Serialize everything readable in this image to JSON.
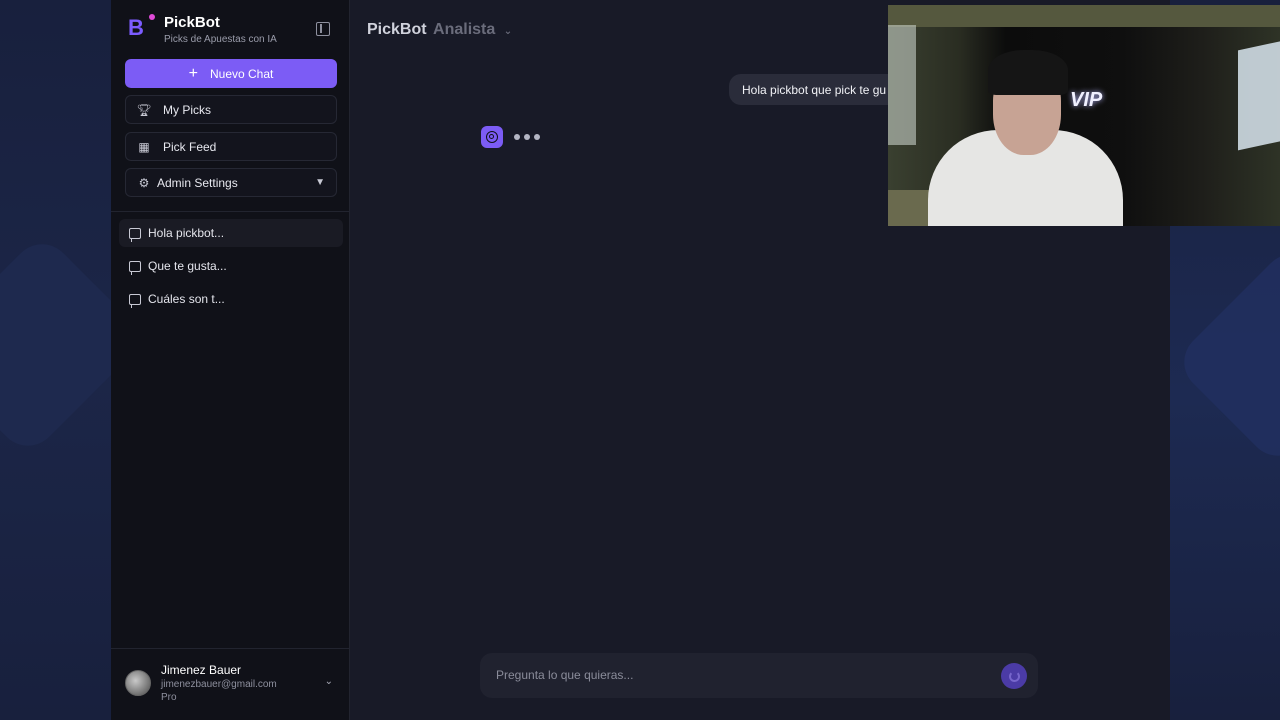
{
  "app": {
    "name": "PickBot",
    "tagline": "Picks de Apuestas con IA"
  },
  "sidebar": {
    "new_chat_label": "Nuevo Chat",
    "nav": [
      {
        "label": "My Picks",
        "icon": "trophy-icon"
      },
      {
        "label": "Pick Feed",
        "icon": "grid-icon"
      },
      {
        "label": "Admin Settings",
        "icon": "gear-icon"
      }
    ],
    "chats": [
      {
        "label": "Hola pickbot..."
      },
      {
        "label": "Que te gusta..."
      },
      {
        "label": "Cuáles son t..."
      }
    ]
  },
  "user": {
    "name": "Jimenez Bauer",
    "email": "jimenezbauer@gmail.com",
    "plan": "Pro"
  },
  "header": {
    "model": "PickBot",
    "mode": "Analista"
  },
  "conversation": {
    "user_message": "Hola pickbot que pick te gu"
  },
  "composer": {
    "placeholder": "Pregunta lo que quieras..."
  },
  "webcam": {
    "sign_text": "VIP"
  },
  "colors": {
    "accent": "#7c5cf5",
    "sidebar_bg": "#101118",
    "main_bg": "#181a27"
  }
}
